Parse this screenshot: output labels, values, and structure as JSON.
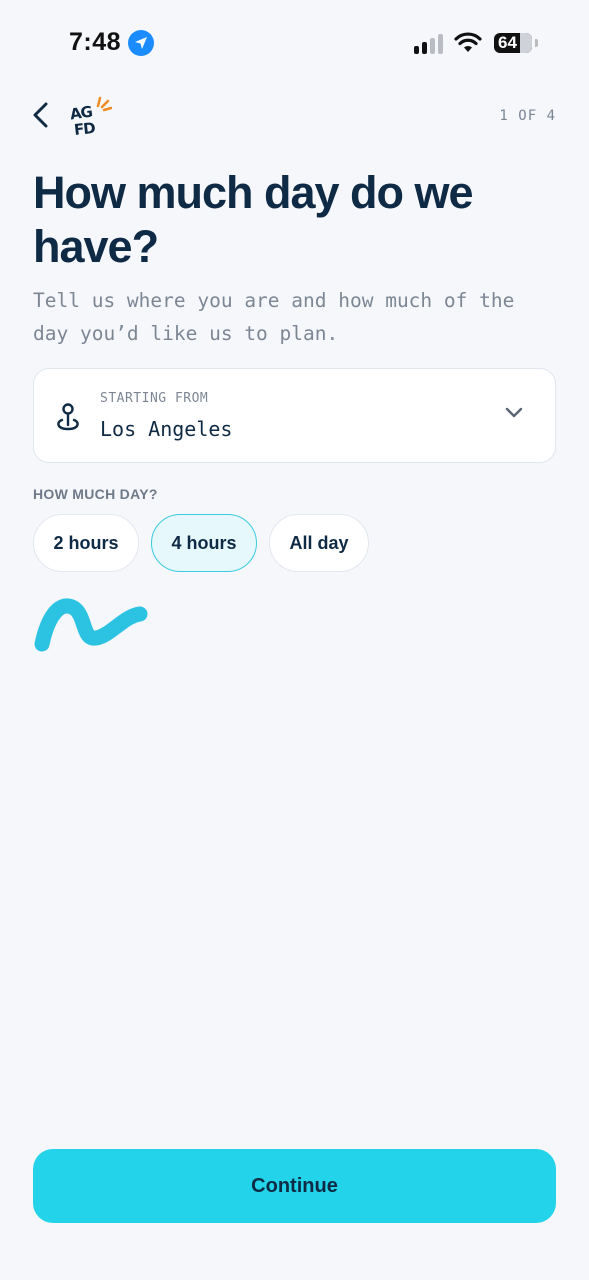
{
  "status_bar": {
    "time": "7:48",
    "battery": "64",
    "location_icon": "location-arrow-icon",
    "signal_icon": "cellular-signal-icon",
    "wifi_icon": "wifi-icon"
  },
  "header": {
    "back_icon": "chevron-left-icon",
    "logo_line1": "AG",
    "logo_line2": "FD",
    "step": "1 OF 4"
  },
  "title": "How much day do we have?",
  "subtitle": "Tell us where you are and how much of the day you’d like us to plan.",
  "starting_from": {
    "label": "STARTING FROM",
    "value": "Los Angeles",
    "icon": "map-pin-icon",
    "dropdown_icon": "chevron-down-icon"
  },
  "duration": {
    "label": "HOW MUCH DAY?",
    "options": [
      {
        "label": "2 hours",
        "selected": false
      },
      {
        "label": "4 hours",
        "selected": true
      },
      {
        "label": "All day",
        "selected": false
      }
    ]
  },
  "continue_label": "Continue",
  "colors": {
    "accent": "#22d3ea",
    "text_dark": "#0f2a44",
    "background": "#f5f7fb",
    "logo_accent": "#f08a24"
  }
}
